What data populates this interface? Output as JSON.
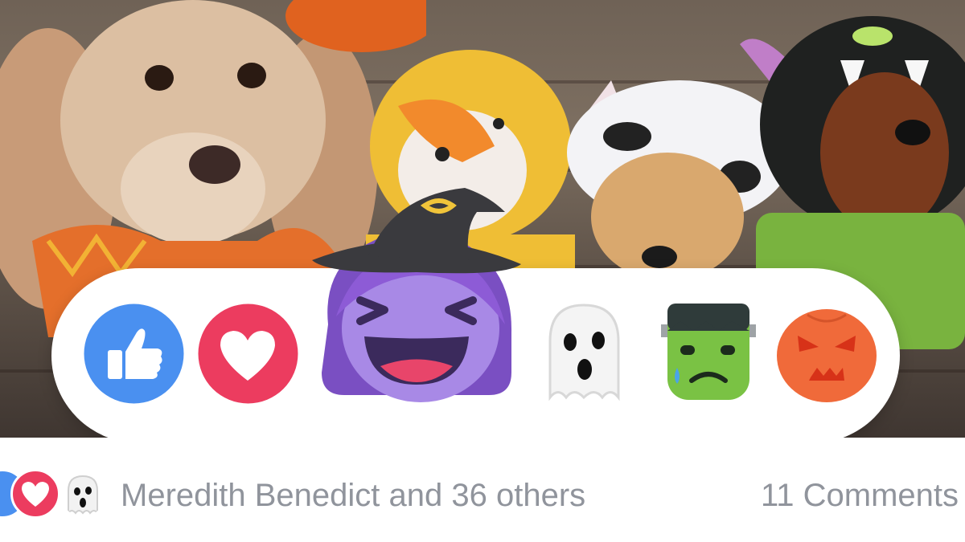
{
  "post": {
    "photo_alt": "Dogs in Halloween costumes",
    "reactions": [
      {
        "id": "like",
        "label": "Like",
        "icon": "thumbs-up-icon",
        "color": "#4a90f0"
      },
      {
        "id": "love",
        "label": "Love",
        "icon": "heart-icon",
        "color": "#ec3c5f"
      },
      {
        "id": "haha",
        "label": "Haha",
        "icon": "witch-laughing-icon",
        "color": "#9b70d8",
        "selected": true
      },
      {
        "id": "wow",
        "label": "Wow",
        "icon": "ghost-icon",
        "color": "#e6e6e6"
      },
      {
        "id": "sad",
        "label": "Sad",
        "icon": "frankenstein-icon",
        "color": "#7ac244"
      },
      {
        "id": "angry",
        "label": "Angry",
        "icon": "angry-pumpkin-icon",
        "color": "#f06a3a"
      }
    ],
    "summary": {
      "reactors_text": "Meredith Benedict and 36 others",
      "comments_text": "11 Comments"
    }
  }
}
